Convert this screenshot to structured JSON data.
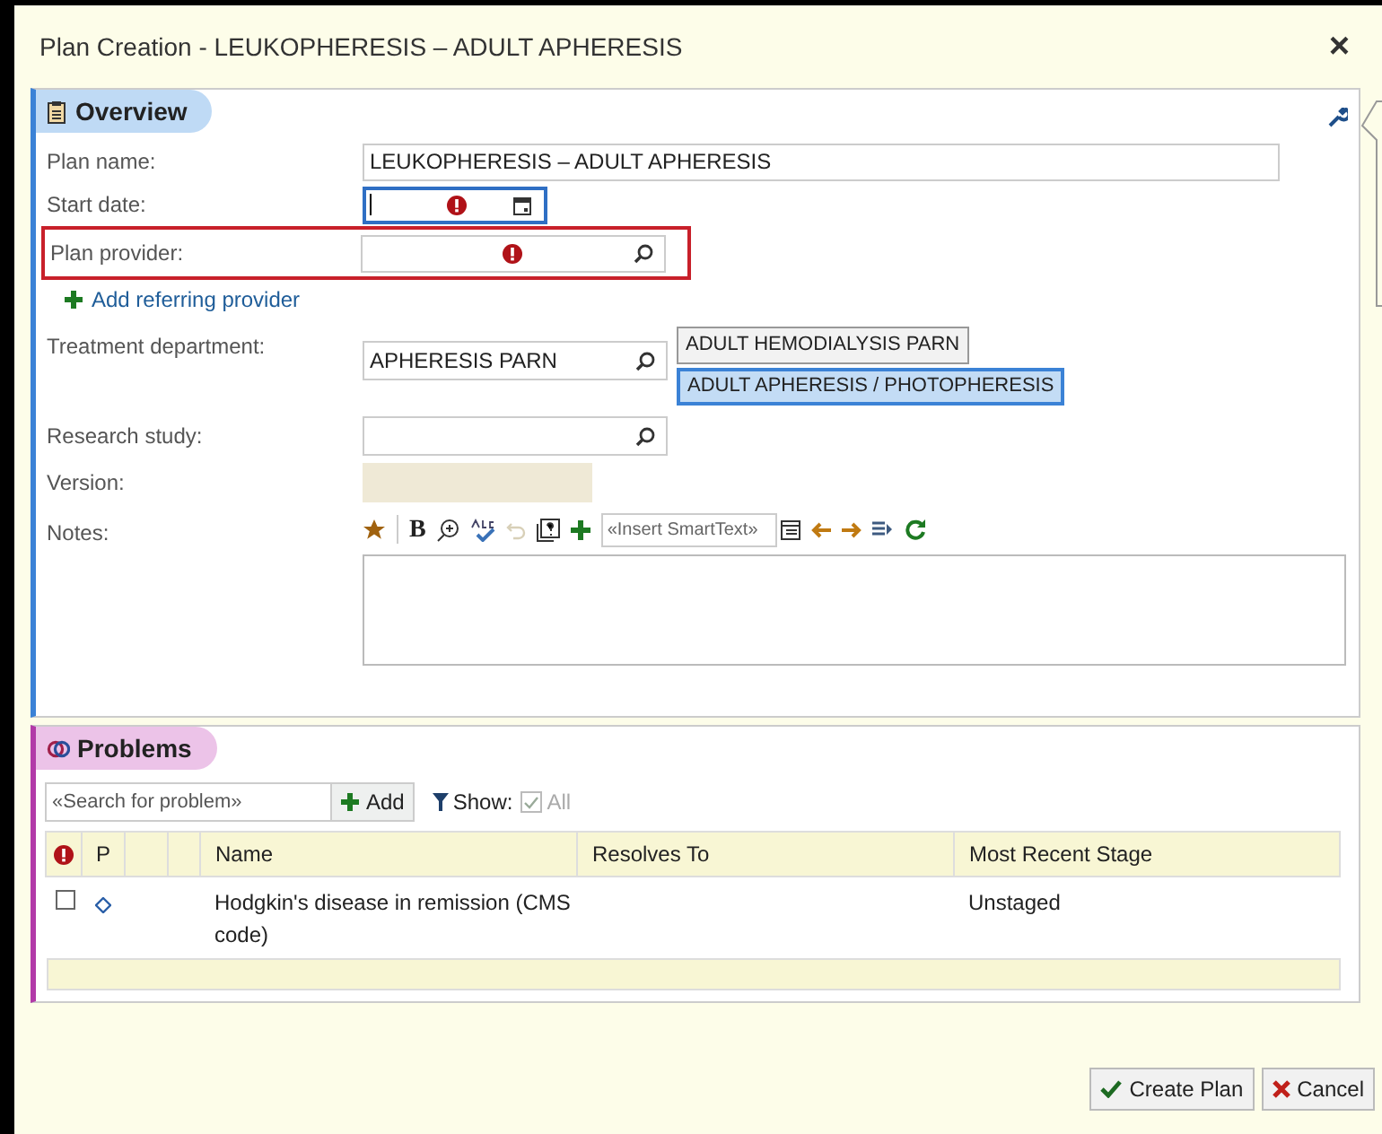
{
  "window": {
    "title": "Plan Creation - LEUKOPHERESIS – ADULT APHERESIS",
    "close": "×"
  },
  "overview": {
    "title": "Overview",
    "plan_name": {
      "label": "Plan name:",
      "value": "LEUKOPHERESIS – ADULT APHERESIS"
    },
    "start_date": {
      "label": "Start date:",
      "required": true,
      "focused": true
    },
    "plan_provider": {
      "label": "Plan provider:",
      "required": true,
      "error_highlight": true
    },
    "add_referring_provider": "Add referring provider",
    "treatment_department": {
      "label": "Treatment department:",
      "value": "APHERESIS PARN",
      "options": [
        {
          "label": "ADULT HEMODIALYSIS PARN",
          "selected": false
        },
        {
          "label": "ADULT APHERESIS / PHOTOPHERESIS",
          "selected": true
        }
      ]
    },
    "research_study": {
      "label": "Research study:"
    },
    "version": {
      "label": "Version:"
    },
    "notes": {
      "label": "Notes:",
      "bold_button": "B",
      "smarttext_placeholder": "«Insert SmartText»",
      "undo_disabled": true
    }
  },
  "problems": {
    "title": "Problems",
    "search_placeholder": "«Search for problem»",
    "add_button": "Add",
    "show_label": "Show:",
    "show_all": {
      "label": "All",
      "checked": true,
      "disabled": true
    },
    "columns": [
      "P",
      "Name",
      "Resolves To",
      "Most Recent Stage"
    ],
    "rows": [
      {
        "checked": false,
        "name": "Hodgkin's disease in remission (CMS code)",
        "resolves_to": "",
        "stage": "Unstaged"
      }
    ]
  },
  "buttons": [
    {
      "kind": "confirm",
      "label": "Create Plan"
    },
    {
      "kind": "cancel",
      "label": "Cancel"
    }
  ]
}
